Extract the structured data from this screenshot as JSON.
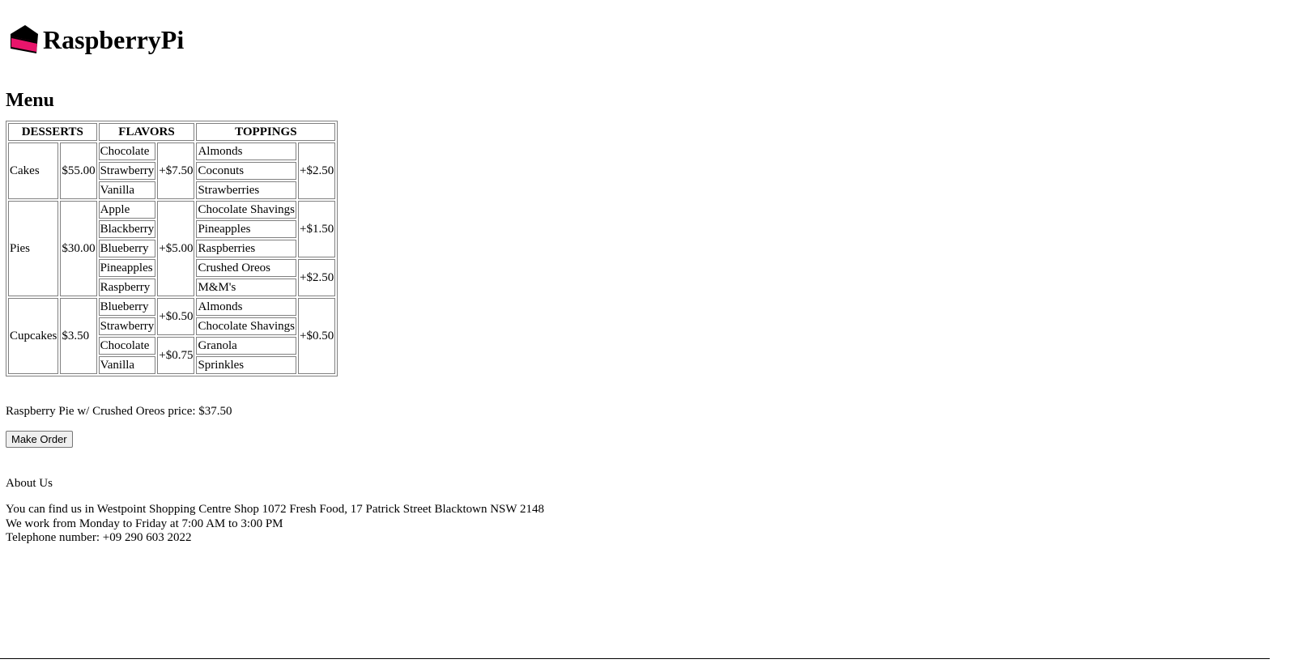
{
  "brand": {
    "name": "RaspberryPi",
    "logo_icon": "cake-slice-icon",
    "logo_colors": {
      "body": "#e8156b",
      "top": "#000000"
    }
  },
  "menu": {
    "title": "Menu",
    "headers": [
      "DESSERTS",
      "FLAVORS",
      "TOPPINGS"
    ],
    "desserts": [
      {
        "name": "Cakes",
        "price": "$55.00",
        "flavor_groups": [
          {
            "flavors": [
              "Chocolate",
              "Strawberry",
              "Vanilla"
            ],
            "price": "+$7.50"
          }
        ],
        "topping_groups": [
          {
            "toppings": [
              "Almonds",
              "Coconuts",
              "Strawberries"
            ],
            "price": "+$2.50"
          }
        ]
      },
      {
        "name": "Pies",
        "price": "$30.00",
        "flavor_groups": [
          {
            "flavors": [
              "Apple",
              "Blackberry",
              "Blueberry",
              "Pineapples",
              "Raspberry"
            ],
            "price": "+$5.00"
          }
        ],
        "topping_groups": [
          {
            "toppings": [
              "Chocolate Shavings",
              "Pineapples",
              "Raspberries"
            ],
            "price": "+$1.50"
          },
          {
            "toppings": [
              "Crushed Oreos",
              "M&M's"
            ],
            "price": "+$2.50"
          }
        ]
      },
      {
        "name": "Cupcakes",
        "price": "$3.50",
        "flavor_groups": [
          {
            "flavors": [
              "Blueberry",
              "Strawberry"
            ],
            "price": "+$0.50"
          },
          {
            "flavors": [
              "Chocolate",
              "Vanilla"
            ],
            "price": "+$0.75"
          }
        ],
        "topping_groups": [
          {
            "toppings": [
              "Almonds",
              "Chocolate Shavings",
              "Granola",
              "Sprinkles"
            ],
            "price": "+$0.50"
          }
        ]
      }
    ]
  },
  "price_summary": "Raspberry Pie w/ Crushed Oreos price: $37.50",
  "order_button": "Make Order",
  "about": {
    "title": "About Us",
    "lines": [
      "You can find us in Westpoint Shopping Centre Shop 1072 Fresh Food, 17 Patrick Street Blacktown NSW 2148",
      "We work from Monday to Friday at 7:00 AM to 3:00 PM",
      "Telephone number: +09 290 603 2022"
    ]
  }
}
